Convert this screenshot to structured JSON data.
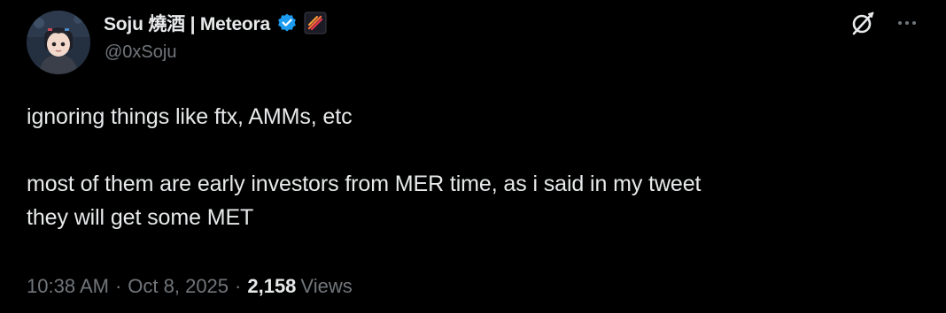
{
  "colors": {
    "background": "#000000",
    "text_primary": "#e7e9ea",
    "text_secondary": "#71767b",
    "verified_blue": "#1d9bf0"
  },
  "author": {
    "display_name": "Soju 燒酒 | Meteora",
    "handle": "@0xSoju",
    "avatar_icon": "avatar-illustration",
    "verified_icon": "verified-badge-icon",
    "affiliate_icon": "meteora-affiliate-badge"
  },
  "actions": {
    "grok_icon": "grok-icon",
    "more_icon": "more-icon"
  },
  "tweet": {
    "line1": "ignoring things like ftx, AMMs, etc",
    "line2": "most of them are early investors from MER time, as i said in my tweet",
    "line3": "they will get some MET"
  },
  "meta": {
    "time": "10:38 AM",
    "date": "Oct 8, 2025",
    "separator": "·",
    "views_count": "2,158",
    "views_label": "Views"
  }
}
